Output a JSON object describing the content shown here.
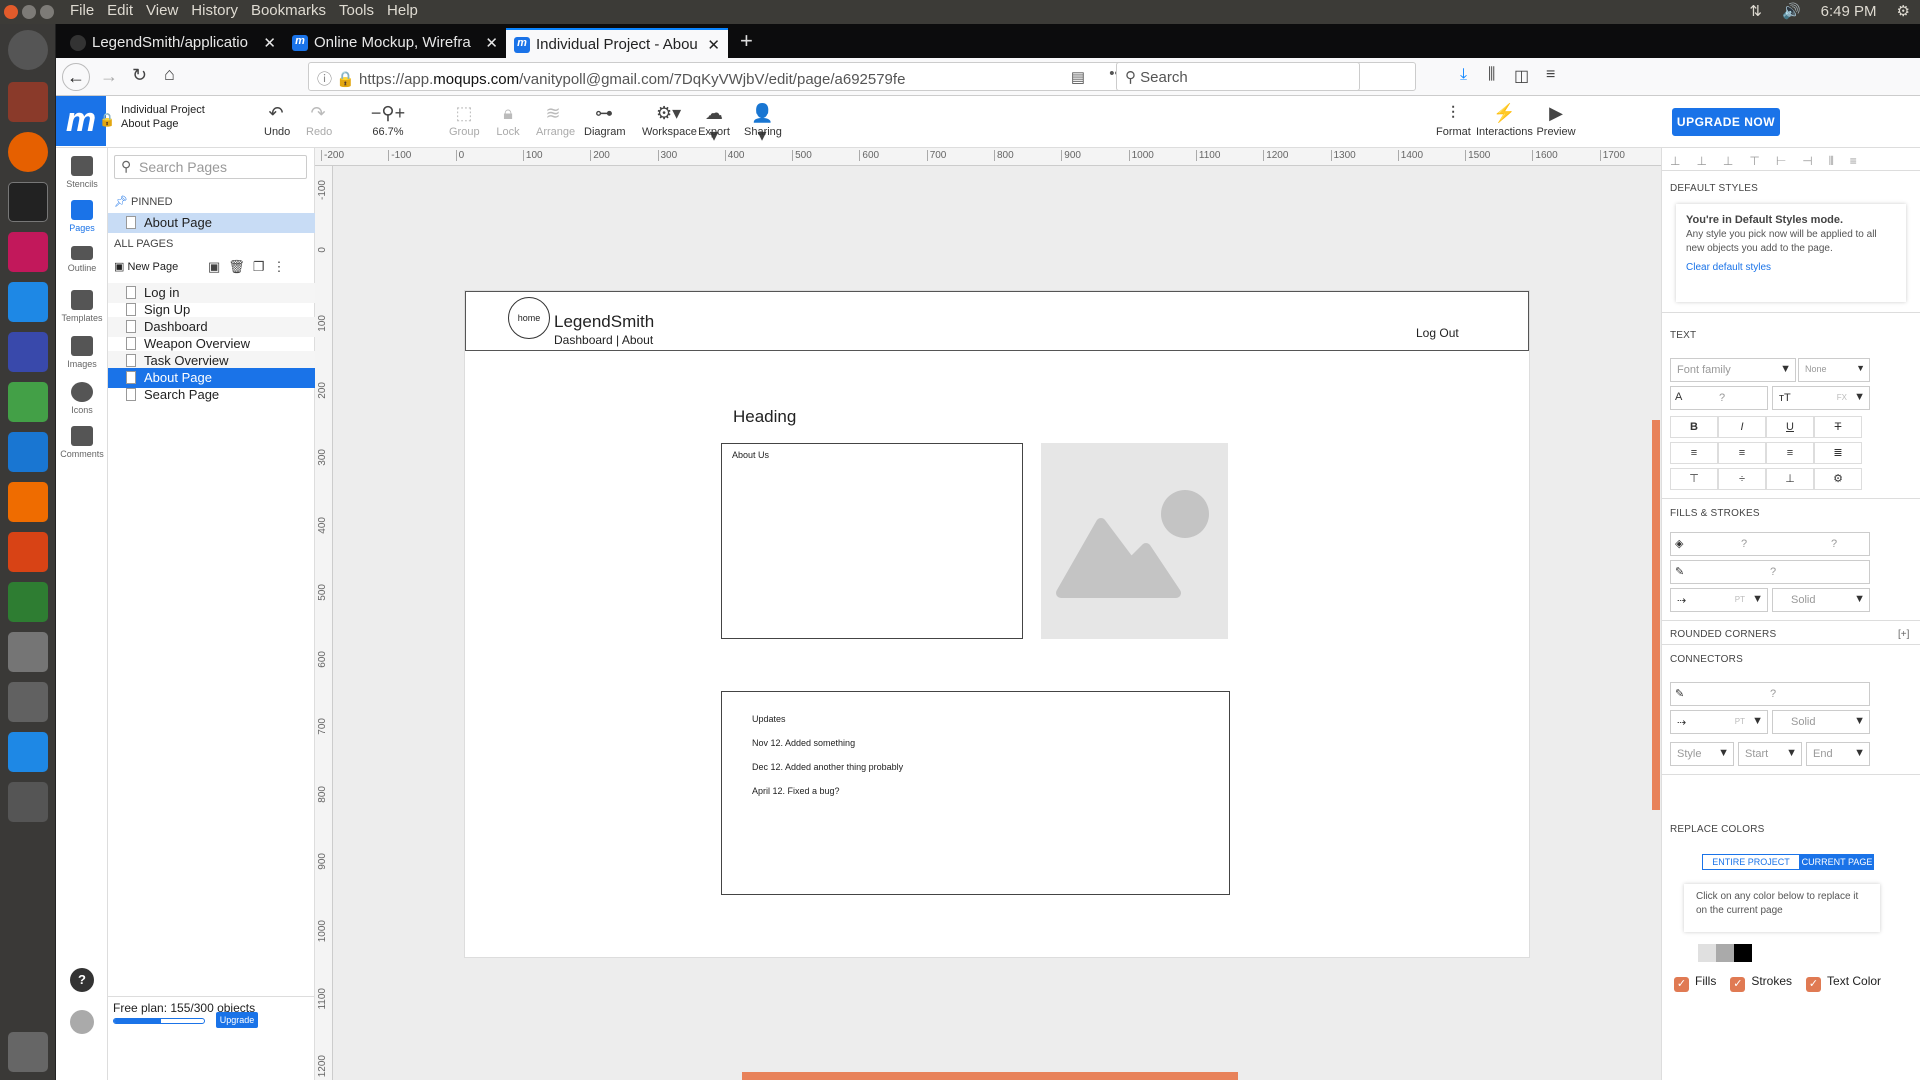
{
  "os": {
    "menu": [
      "File",
      "Edit",
      "View",
      "History",
      "Bookmarks",
      "Tools",
      "Help"
    ],
    "clock": "6:49 PM"
  },
  "browser": {
    "tabs": [
      {
        "label": "LegendSmith/applicatio",
        "active": false
      },
      {
        "label": "Online Mockup, Wirefra",
        "active": false
      },
      {
        "label": "Individual Project - Abou",
        "active": true
      }
    ],
    "url_prefix": "https://app.",
    "url_domain": "moqups.com",
    "url_rest": "/vanitypoll@gmail.com/7DqKyVWjbV/edit/page/a692579fe",
    "search_placeholder": "Search"
  },
  "app": {
    "logo": "m",
    "project_name": "Individual Project",
    "page_name": "About Page",
    "toolbar": {
      "undo": "Undo",
      "redo": "Redo",
      "zoom": "66.7%",
      "group": "Group",
      "lock": "Lock",
      "arrange": "Arrange",
      "diagram": "Diagram",
      "workspace": "Workspace",
      "export": "Export",
      "sharing": "Sharing",
      "upgrade": "UPGRADE NOW",
      "format": "Format",
      "interactions": "Interactions",
      "preview": "Preview"
    },
    "rail": {
      "stencils": "Stencils",
      "pages": "Pages",
      "outline": "Outline",
      "templates": "Templates",
      "images": "Images",
      "icons": "Icons",
      "comments": "Comments"
    },
    "pages_panel": {
      "search_placeholder": "Search Pages",
      "pinned_label": "PINNED",
      "pinned_items": [
        "About Page"
      ],
      "all_label": "ALL PAGES",
      "new_page": "New Page",
      "items": [
        "Log in",
        "Sign Up",
        "Dashboard",
        "Weapon Overview",
        "Task Overview",
        "About Page",
        "Search Page"
      ],
      "selected": "About Page",
      "plan": "Free plan: 155/300 objects",
      "plan_usage": 0.52,
      "upgrade": "Upgrade"
    },
    "rulers": {
      "top": [
        "-200",
        "-100",
        "0",
        "100",
        "200",
        "300",
        "400",
        "500",
        "600",
        "700",
        "800",
        "900",
        "1000",
        "1100",
        "1200",
        "1300",
        "1400",
        "1500",
        "1600",
        "1700"
      ],
      "left": [
        "-100",
        "0",
        "100",
        "200",
        "300",
        "400",
        "500",
        "600",
        "700",
        "800",
        "900",
        "1000",
        "1100",
        "1200"
      ]
    },
    "mockup": {
      "home_label": "home",
      "site_title": "LegendSmith",
      "nav": "Dashboard | About",
      "logout": "Log Out",
      "heading": "Heading",
      "about_us": "About Us",
      "updates_title": "Updates",
      "updates": [
        "Nov 12. Added something",
        "Dec 12. Added another thing probably",
        "April 12. Fixed a bug?"
      ]
    },
    "right_panel": {
      "default_styles": "DEFAULT STYLES",
      "mode_title": "You're in Default Styles mode.",
      "mode_text": "Any style you pick now will be applied to all new objects you add to the page.",
      "clear_link": "Clear default styles",
      "text_section": "TEXT",
      "font_family": "Font family",
      "font_none": "None",
      "q": "?",
      "fx": "FX",
      "pt": "PT",
      "fills_strokes": "FILLS & STROKES",
      "solid": "Solid",
      "rounded_corners": "ROUNDED CORNERS",
      "rc_toggle": "[+]",
      "connectors": "CONNECTORS",
      "style": "Style",
      "start": "Start",
      "end": "End",
      "replace_colors": "REPLACE COLORS",
      "entire_project": "ENTIRE PROJECT",
      "current_page": "CURRENT PAGE",
      "replace_hint": "Click on any color below to replace it on the current page",
      "swatches": [
        "#ffffff",
        "#e0e0e0",
        "#aaaaaa",
        "#000000"
      ],
      "fills": "Fills",
      "strokes": "Strokes",
      "text_color": "Text Color"
    },
    "colors": {
      "accent": "#1a73e8",
      "orange": "#e8825a"
    }
  }
}
